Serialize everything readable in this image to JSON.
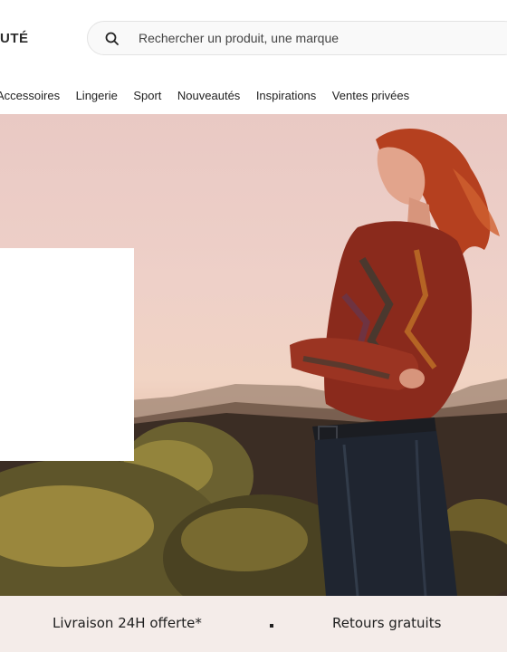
{
  "header": {
    "brand": "UTÉ",
    "search": {
      "placeholder": "Rechercher un produit, une marque",
      "icon": "search-icon"
    }
  },
  "nav": {
    "items": [
      "Accessoires",
      "Lingerie",
      "Sport",
      "Nouveautés",
      "Inspirations",
      "Ventes privées"
    ]
  },
  "hero": {
    "image": "woman-red-hair-patterned-blouse-leather-skirt-volcanic-landscape"
  },
  "benefits": {
    "item_1": "Livraison 24H offerte*",
    "item_2": "Retours gratuits"
  },
  "colors": {
    "benefits_bg": "#f4ece9",
    "sky": "#eed0c8",
    "hair": "#b5401f",
    "blouse": "#8a2a1c"
  }
}
